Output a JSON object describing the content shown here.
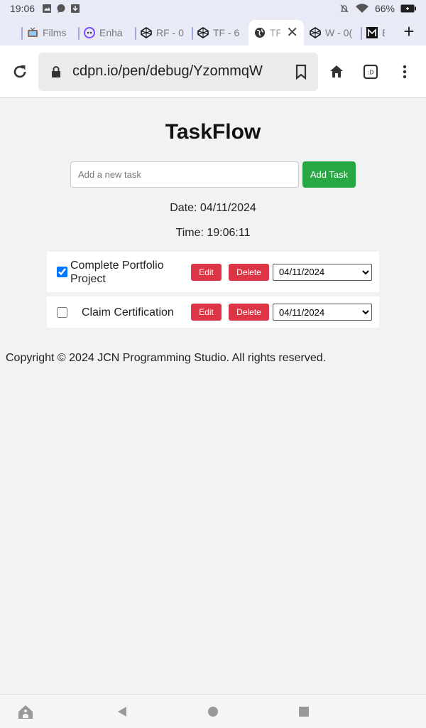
{
  "status_bar": {
    "time": "19:06",
    "battery": "66%"
  },
  "tabs": [
    {
      "label": "Films",
      "icon": "tv-icon"
    },
    {
      "label": "Enha",
      "icon": "face-icon"
    },
    {
      "label": "RF - 0",
      "icon": "codepen-icon"
    },
    {
      "label": "TF - 6",
      "icon": "codepen-icon"
    },
    {
      "label": "TF",
      "icon": "globe-icon",
      "active": true
    },
    {
      "label": "W - 0(",
      "icon": "codepen-icon"
    },
    {
      "label": "E",
      "icon": "m-logo-icon"
    }
  ],
  "toolbar": {
    "url": "cdpn.io/pen/debug/YzommqW"
  },
  "app": {
    "title": "TaskFlow",
    "input_placeholder": "Add a new task",
    "add_button": "Add Task",
    "date_line": "Date: 04/11/2024",
    "time_line": "Time: 19:06:11",
    "tasks": [
      {
        "name": "Complete Portfolio Project",
        "completed": true,
        "edit_label": "Edit",
        "delete_label": "Delete",
        "date": "04/11/2024"
      },
      {
        "name": "Claim Certification",
        "completed": false,
        "edit_label": "Edit",
        "delete_label": "Delete",
        "date": "04/11/2024"
      }
    ],
    "footer": "Copyright © 2024 JCN Programming Studio. All rights reserved."
  },
  "colors": {
    "add_button": "#28a745",
    "danger_button": "#dc3545",
    "tab_strip": "#e8eaf6"
  }
}
